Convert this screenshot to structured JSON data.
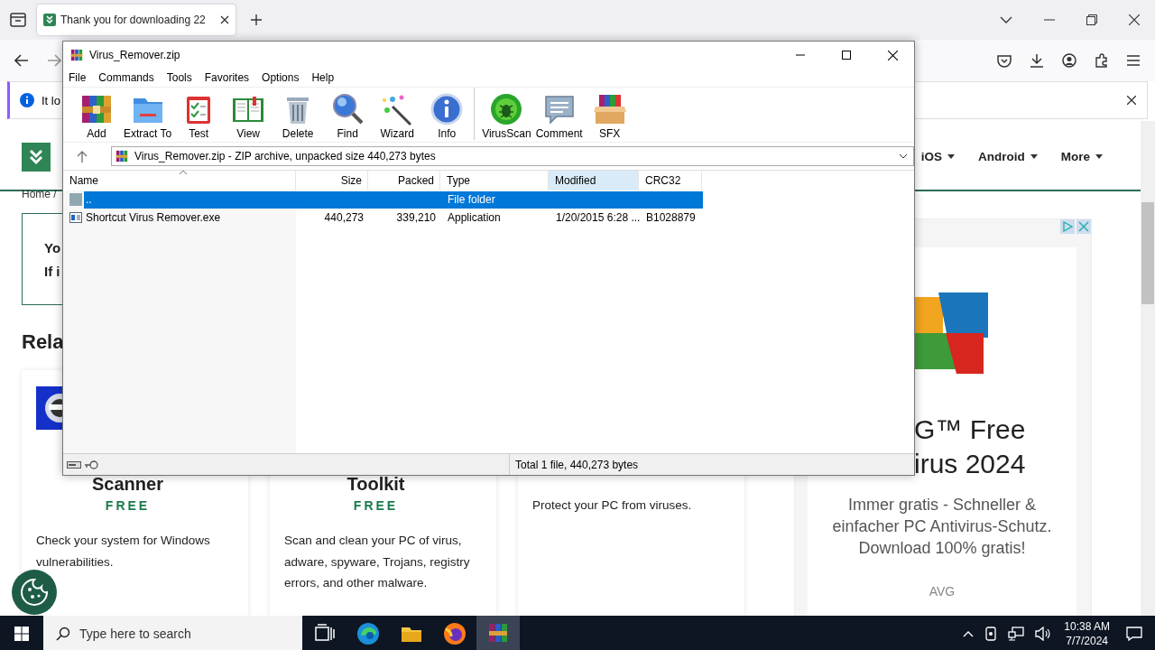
{
  "browser": {
    "tabs": [
      {
        "title": "Thank you for downloading 22",
        "selected": true
      }
    ],
    "notification": {
      "text": "It lo"
    }
  },
  "page": {
    "nav": [
      {
        "label": "iOS"
      },
      {
        "label": "Android"
      },
      {
        "label": "More"
      }
    ],
    "breadcrumb": "Home /",
    "notice_lines": [
      "Yo",
      "If i"
    ],
    "related_heading": "Rela",
    "cards": [
      {
        "kind": "image",
        "title": "Scanner",
        "price": "FREE",
        "description": "Check your system for Windows vulnerabilities."
      },
      {
        "kind": "plain",
        "title": "Toolkit",
        "price": "FREE",
        "description": "Scan and clean your PC of virus, adware, spyware, Trojans, registry errors, and other malware."
      },
      {
        "kind": "untitled",
        "description": "Protect your PC from viruses."
      }
    ],
    "ad": {
      "title_lines": [
        "G™ Free",
        "irus 2024"
      ],
      "description": "Immer gratis - Schneller & einfacher PC Antivirus-Schutz. Download 100% gratis!",
      "advertiser": "AVG"
    }
  },
  "winrar": {
    "title": "Virus_Remover.zip",
    "menu": [
      "File",
      "Commands",
      "Tools",
      "Favorites",
      "Options",
      "Help"
    ],
    "toolbar": [
      {
        "kind": "add",
        "label": "Add",
        "separator_before": false
      },
      {
        "kind": "extract",
        "label": "Extract To",
        "separator_before": false
      },
      {
        "kind": "test",
        "label": "Test",
        "separator_before": false
      },
      {
        "kind": "view",
        "label": "View",
        "separator_before": false
      },
      {
        "kind": "delete",
        "label": "Delete",
        "separator_before": false
      },
      {
        "kind": "find",
        "label": "Find",
        "separator_before": false
      },
      {
        "kind": "wizard",
        "label": "Wizard",
        "separator_before": false
      },
      {
        "kind": "info",
        "label": "Info",
        "separator_before": false
      },
      {
        "kind": "virusscan",
        "label": "VirusScan",
        "separator_before": true
      },
      {
        "kind": "comment",
        "label": "Comment",
        "separator_before": false
      },
      {
        "kind": "sfx",
        "label": "SFX",
        "separator_before": false
      }
    ],
    "path": "Virus_Remover.zip - ZIP archive, unpacked size 440,273 bytes",
    "columns": [
      {
        "label": "Name",
        "sorted": true,
        "highlighted": false
      },
      {
        "label": "Size",
        "sorted": false,
        "highlighted": false
      },
      {
        "label": "Packed",
        "sorted": false,
        "highlighted": false
      },
      {
        "label": "Type",
        "sorted": false,
        "highlighted": false
      },
      {
        "label": "Modified",
        "sorted": false,
        "highlighted": true
      },
      {
        "label": "CRC32",
        "sorted": false,
        "highlighted": false
      }
    ],
    "rows": [
      {
        "kind": "folder",
        "selected": true,
        "cells": [
          "..",
          "",
          "",
          "File folder",
          "",
          ""
        ]
      },
      {
        "kind": "exe",
        "selected": false,
        "cells": [
          "Shortcut Virus Remover.exe",
          "440,273",
          "339,210",
          "Application",
          "1/20/2015 6:28 ...",
          "B1028879"
        ]
      }
    ],
    "status": "Total 1 file, 440,273 bytes"
  },
  "taskbar": {
    "search": {
      "placeholder": "Type here to search"
    },
    "apps": [
      {
        "kind": "taskview",
        "selected": false
      },
      {
        "kind": "edge",
        "selected": false
      },
      {
        "kind": "explorer",
        "selected": false
      },
      {
        "kind": "firefox",
        "selected": false
      },
      {
        "kind": "winrar",
        "selected": true
      }
    ],
    "time": "10:38 AM",
    "date": "7/7/2024"
  }
}
